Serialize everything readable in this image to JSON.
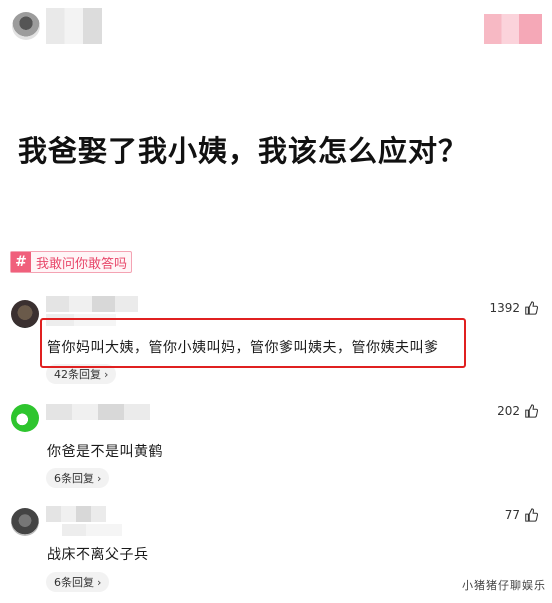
{
  "question": {
    "title": "我爸娶了我小姨，我该怎么应对？",
    "topic_tag": "我敢问你敢答吗",
    "topic_icon": "hash-icon"
  },
  "comments": [
    {
      "text": "管你妈叫大姨，管你小姨叫妈，管你爹叫姨夫，管你姨夫叫爹",
      "likes": "1392",
      "replies": "42条回复"
    },
    {
      "text": "你爸是不是叫黄鹤",
      "likes": "202",
      "replies": "6条回复"
    },
    {
      "text": "战床不离父子兵",
      "likes": "77",
      "replies": "6条回复"
    }
  ],
  "watermark": "小猪猪仔聊娱乐",
  "colors": {
    "accent": "#f0607c",
    "highlight": "#e02020"
  }
}
